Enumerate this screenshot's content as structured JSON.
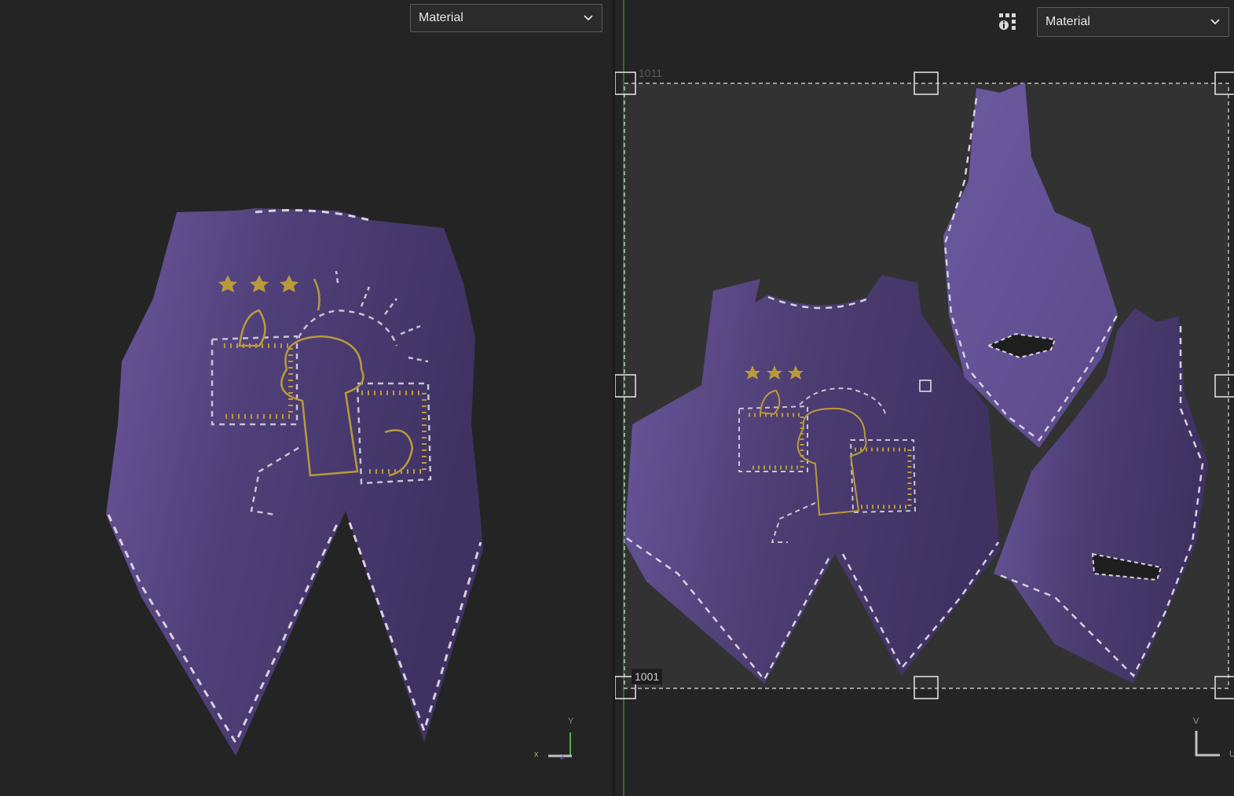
{
  "left_viewport": {
    "dropdown": {
      "label": "Material",
      "icon": "chevron-down-icon"
    },
    "axis_gizmo": {
      "x_label": "x",
      "y_label": "Y",
      "z_label": "z"
    }
  },
  "right_viewport": {
    "dropdown": {
      "label": "Material",
      "icon": "chevron-down-icon"
    },
    "info_button": {
      "icon": "display-info-icon"
    },
    "tiles": {
      "top_label": "1011",
      "bottom_label": "1001"
    },
    "axis_gizmo": {
      "v_label": "V",
      "u_label": "U"
    }
  },
  "colors": {
    "background": "#222222",
    "fabric": "#4f3f78",
    "fabric_light": "#6a579c",
    "stitch": "#d8d0e0",
    "embroidery": "#b99a3a",
    "uv_tile_fill": "#323232",
    "guide_green": "#2d8a2d"
  }
}
